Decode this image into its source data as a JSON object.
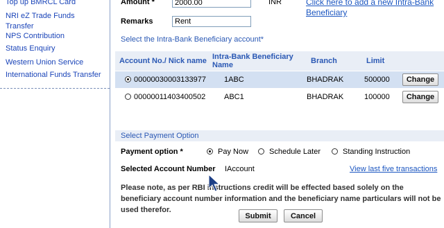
{
  "sidebar": {
    "items": [
      "Top up BMRCL Card",
      "NRI eZ Trade Funds",
      "Transfer",
      "NPS Contribution",
      "Status Enquiry",
      "Western Union Service",
      "International Funds Transfer"
    ]
  },
  "form": {
    "amount_label": "Amount *",
    "amount_value": "2000.00",
    "currency": "INR",
    "add_beneficiary_link_line1": "Click here to add a new Intra-Bank",
    "add_beneficiary_link_line2": "Beneficiary",
    "remarks_label": "Remarks",
    "remarks_value": "Rent",
    "select_beneficiary_label": "Select the Intra-Bank Beneficiary account*"
  },
  "table": {
    "headers": [
      "Account No./ Nick name",
      "Intra-Bank Beneficiary Name",
      "Branch",
      "Limit"
    ],
    "rows": [
      {
        "account": "00000030003133977",
        "name": "1ABC",
        "branch": "BHADRAK",
        "limit": "500000",
        "button": "Change",
        "selected": true
      },
      {
        "account": "00000011403400502",
        "name": "ABC1",
        "branch": "BHADRAK",
        "limit": "100000",
        "button": "Change",
        "selected": false
      }
    ]
  },
  "payment": {
    "section_title": "Select Payment Option",
    "option_label": "Payment option *",
    "options": [
      "Pay Now",
      "Schedule Later",
      "Standing Instruction"
    ],
    "selected_option": "Pay Now",
    "selected_account_label": "Selected Account Number",
    "selected_account_value": "IAccount",
    "view_transactions_link": "View last five transactions",
    "note": "Please note, as per RBI instructions credit will be effected based solely on the beneficiary account number information and the beneficiary name particulars will not be used therefor."
  },
  "actions": {
    "submit": "Submit",
    "cancel": "Cancel"
  },
  "colors": {
    "link": "#1a55c0",
    "header_text": "#2a58b4",
    "header_bg": "#e9eef6",
    "selected_row_bg": "#d3e0f2"
  }
}
